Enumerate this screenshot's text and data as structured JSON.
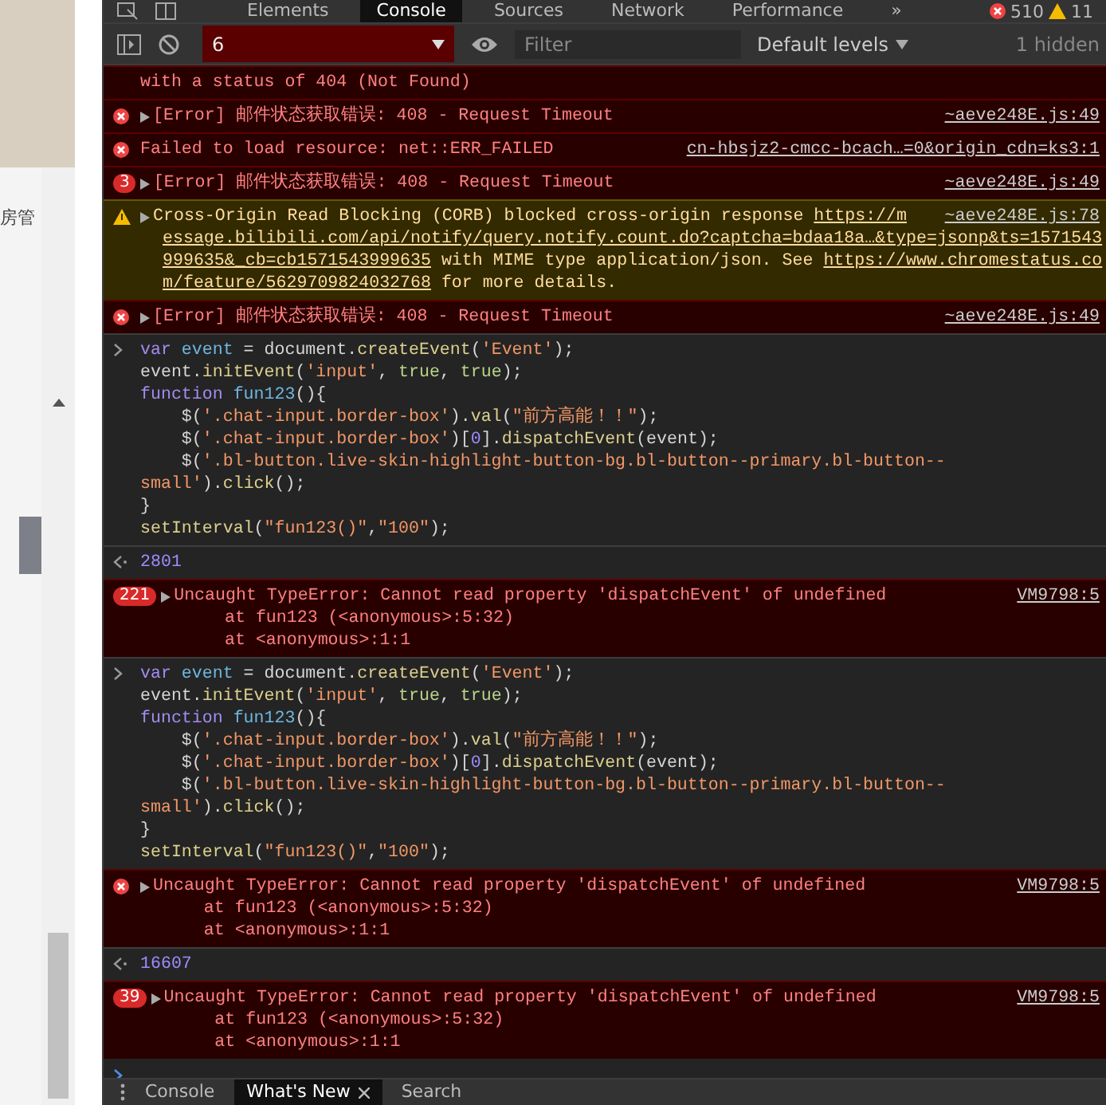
{
  "page": {
    "label": "房管"
  },
  "tabs": [
    {
      "label": "Elements",
      "selected": false
    },
    {
      "label": "Console",
      "selected": true
    },
    {
      "label": "Sources",
      "selected": false
    },
    {
      "label": "Network",
      "selected": false
    },
    {
      "label": "Performance",
      "selected": false
    }
  ],
  "more_tabs": "»",
  "error_count": "510",
  "warning_count": "11",
  "toolbar": {
    "context": "6",
    "filter_placeholder": "Filter",
    "levels": "Default levels",
    "hidden": "1 hidden"
  },
  "messages": [
    {
      "kind": "error",
      "icon": false,
      "expandable": false,
      "lines": [
        [
          {
            "text": "with a status of 404 (Not Found)",
            "kind": "plain"
          }
        ]
      ]
    },
    {
      "kind": "error",
      "icon": true,
      "expandable": true,
      "source": "~aeve248E.js:49",
      "lines": [
        [
          {
            "text": "[Error] 邮件状态获取错误: 408 - Request Timeout",
            "kind": "plain"
          }
        ]
      ]
    },
    {
      "kind": "error",
      "icon": true,
      "expandable": false,
      "source": "cn-hbsjz2-cmcc-bcach…=0&origin_cdn=ks3:1",
      "lines": [
        [
          {
            "text": "Failed to load resource: net::ERR_FAILED",
            "kind": "plain"
          }
        ]
      ]
    },
    {
      "kind": "error",
      "icon": false,
      "count": "3",
      "expandable": true,
      "source": "~aeve248E.js:49",
      "lines": [
        [
          {
            "text": "[Error] 邮件状态获取错误: 408 - Request Timeout",
            "kind": "plain"
          }
        ]
      ]
    },
    {
      "kind": "warning",
      "icon": true,
      "expandable": true,
      "source": "~aeve248E.js:78",
      "lines": [
        [
          {
            "text": "Cross-Origin Read Blocking (CORB) blocked cross-origin response ",
            "kind": "plain"
          },
          {
            "text": "https://m",
            "kind": "link"
          }
        ],
        [
          {
            "text": "essage.bilibili.com/api/notify/query.notify.count.do?captcha=bdaa18a…&type=jsonp&ts=1571543",
            "kind": "link"
          }
        ],
        [
          {
            "text": "999635&_cb=cb1571543999635",
            "kind": "link"
          },
          {
            "text": " with MIME type application/json. See ",
            "kind": "plain"
          },
          {
            "text": "https://www.chromestatus.co",
            "kind": "link"
          }
        ],
        [
          {
            "text": "m/feature/5629709824032768",
            "kind": "link"
          },
          {
            "text": " for more details.",
            "kind": "plain"
          }
        ]
      ]
    },
    {
      "kind": "error",
      "icon": true,
      "expandable": true,
      "source": "~aeve248E.js:49",
      "lines": [
        [
          {
            "text": "[Error] 邮件状态获取错误: 408 - Request Timeout",
            "kind": "plain"
          }
        ]
      ]
    },
    {
      "kind": "input",
      "lines": [
        [
          {
            "text": "var ",
            "kind": "keyword"
          },
          {
            "text": "event",
            "kind": "variable"
          },
          {
            "text": " = document.",
            "kind": "plain"
          },
          {
            "text": "createEvent",
            "kind": "property"
          },
          {
            "text": "(",
            "kind": "plain"
          },
          {
            "text": "'Event'",
            "kind": "string"
          },
          {
            "text": ");",
            "kind": "plain"
          }
        ],
        [
          {
            "text": "event.",
            "kind": "plain"
          },
          {
            "text": "initEvent",
            "kind": "property"
          },
          {
            "text": "(",
            "kind": "plain"
          },
          {
            "text": "'input'",
            "kind": "string"
          },
          {
            "text": ", ",
            "kind": "plain"
          },
          {
            "text": "true",
            "kind": "literal"
          },
          {
            "text": ", ",
            "kind": "plain"
          },
          {
            "text": "true",
            "kind": "literal"
          },
          {
            "text": ");",
            "kind": "plain"
          }
        ],
        [
          {
            "text": "function ",
            "kind": "keyword"
          },
          {
            "text": "fun123",
            "kind": "variable"
          },
          {
            "text": "(){",
            "kind": "plain"
          }
        ],
        [
          {
            "text": "    $(",
            "kind": "plain"
          },
          {
            "text": "'.chat-input.border-box'",
            "kind": "string"
          },
          {
            "text": ").",
            "kind": "plain"
          },
          {
            "text": "val",
            "kind": "property"
          },
          {
            "text": "(",
            "kind": "plain"
          },
          {
            "text": "\"前方高能！！\"",
            "kind": "string"
          },
          {
            "text": ");",
            "kind": "plain"
          }
        ],
        [
          {
            "text": "    $(",
            "kind": "plain"
          },
          {
            "text": "'.chat-input.border-box'",
            "kind": "string"
          },
          {
            "text": ")[",
            "kind": "plain"
          },
          {
            "text": "0",
            "kind": "number"
          },
          {
            "text": "].",
            "kind": "plain"
          },
          {
            "text": "dispatchEvent",
            "kind": "property"
          },
          {
            "text": "(event);",
            "kind": "plain"
          }
        ],
        [
          {
            "text": "    $(",
            "kind": "plain"
          },
          {
            "text": "'.bl-button.live-skin-highlight-button-bg.bl-button--primary.bl-button--",
            "kind": "string"
          }
        ],
        [
          {
            "text": "small'",
            "kind": "string"
          },
          {
            "text": ").",
            "kind": "plain"
          },
          {
            "text": "click",
            "kind": "property"
          },
          {
            "text": "();",
            "kind": "plain"
          }
        ],
        [
          {
            "text": "}",
            "kind": "plain"
          }
        ],
        [
          {
            "text": "setInterval",
            "kind": "property"
          },
          {
            "text": "(",
            "kind": "plain"
          },
          {
            "text": "\"fun123()\"",
            "kind": "string"
          },
          {
            "text": ",",
            "kind": "plain"
          },
          {
            "text": "\"100\"",
            "kind": "string"
          },
          {
            "text": ");",
            "kind": "plain"
          }
        ]
      ]
    },
    {
      "kind": "result",
      "lines": [
        [
          {
            "text": "2801",
            "kind": "number"
          }
        ]
      ]
    },
    {
      "kind": "error",
      "icon": false,
      "count": "221",
      "expandable": true,
      "source": "VM9798:5",
      "lines": [
        [
          {
            "text": "Uncaught TypeError: Cannot read property 'dispatchEvent' of undefined",
            "kind": "plain"
          }
        ],
        [
          {
            "text": "    at fun123 (<anonymous>:5:32)",
            "kind": "plain"
          }
        ],
        [
          {
            "text": "    at <anonymous>:1:1",
            "kind": "plain"
          }
        ]
      ]
    },
    {
      "kind": "input",
      "lines": [
        [
          {
            "text": "var ",
            "kind": "keyword"
          },
          {
            "text": "event",
            "kind": "variable"
          },
          {
            "text": " = document.",
            "kind": "plain"
          },
          {
            "text": "createEvent",
            "kind": "property"
          },
          {
            "text": "(",
            "kind": "plain"
          },
          {
            "text": "'Event'",
            "kind": "string"
          },
          {
            "text": ");",
            "kind": "plain"
          }
        ],
        [
          {
            "text": "event.",
            "kind": "plain"
          },
          {
            "text": "initEvent",
            "kind": "property"
          },
          {
            "text": "(",
            "kind": "plain"
          },
          {
            "text": "'input'",
            "kind": "string"
          },
          {
            "text": ", ",
            "kind": "plain"
          },
          {
            "text": "true",
            "kind": "literal"
          },
          {
            "text": ", ",
            "kind": "plain"
          },
          {
            "text": "true",
            "kind": "literal"
          },
          {
            "text": ");",
            "kind": "plain"
          }
        ],
        [
          {
            "text": "function ",
            "kind": "keyword"
          },
          {
            "text": "fun123",
            "kind": "variable"
          },
          {
            "text": "(){",
            "kind": "plain"
          }
        ],
        [
          {
            "text": "    $(",
            "kind": "plain"
          },
          {
            "text": "'.chat-input.border-box'",
            "kind": "string"
          },
          {
            "text": ").",
            "kind": "plain"
          },
          {
            "text": "val",
            "kind": "property"
          },
          {
            "text": "(",
            "kind": "plain"
          },
          {
            "text": "\"前方高能！！\"",
            "kind": "string"
          },
          {
            "text": ");",
            "kind": "plain"
          }
        ],
        [
          {
            "text": "    $(",
            "kind": "plain"
          },
          {
            "text": "'.chat-input.border-box'",
            "kind": "string"
          },
          {
            "text": ")[",
            "kind": "plain"
          },
          {
            "text": "0",
            "kind": "number"
          },
          {
            "text": "].",
            "kind": "plain"
          },
          {
            "text": "dispatchEvent",
            "kind": "property"
          },
          {
            "text": "(event);",
            "kind": "plain"
          }
        ],
        [
          {
            "text": "    $(",
            "kind": "plain"
          },
          {
            "text": "'.bl-button.live-skin-highlight-button-bg.bl-button--primary.bl-button--",
            "kind": "string"
          }
        ],
        [
          {
            "text": "small'",
            "kind": "string"
          },
          {
            "text": ").",
            "kind": "plain"
          },
          {
            "text": "click",
            "kind": "property"
          },
          {
            "text": "();",
            "kind": "plain"
          }
        ],
        [
          {
            "text": "}",
            "kind": "plain"
          }
        ],
        [
          {
            "text": "setInterval",
            "kind": "property"
          },
          {
            "text": "(",
            "kind": "plain"
          },
          {
            "text": "\"fun123()\"",
            "kind": "string"
          },
          {
            "text": ",",
            "kind": "plain"
          },
          {
            "text": "\"100\"",
            "kind": "string"
          },
          {
            "text": ");",
            "kind": "plain"
          }
        ]
      ]
    },
    {
      "kind": "error",
      "icon": true,
      "expandable": true,
      "source": "VM9798:5",
      "lines": [
        [
          {
            "text": "Uncaught TypeError: Cannot read property 'dispatchEvent' of undefined",
            "kind": "plain"
          }
        ],
        [
          {
            "text": "    at fun123 (<anonymous>:5:32)",
            "kind": "plain"
          }
        ],
        [
          {
            "text": "    at <anonymous>:1:1",
            "kind": "plain"
          }
        ]
      ]
    },
    {
      "kind": "result",
      "lines": [
        [
          {
            "text": "16607",
            "kind": "number"
          }
        ]
      ]
    },
    {
      "kind": "error",
      "icon": false,
      "count": "39",
      "expandable": true,
      "source": "VM9798:5",
      "lines": [
        [
          {
            "text": "Uncaught TypeError: Cannot read property 'dispatchEvent' of undefined",
            "kind": "plain"
          }
        ],
        [
          {
            "text": "    at fun123 (<anonymous>:5:32)",
            "kind": "plain"
          }
        ],
        [
          {
            "text": "    at <anonymous>:1:1",
            "kind": "plain"
          }
        ]
      ]
    },
    {
      "kind": "prompt"
    }
  ],
  "drawer_tabs": [
    {
      "label": "Console",
      "selected": false,
      "closable": false
    },
    {
      "label": "What's New",
      "selected": true,
      "closable": true
    },
    {
      "label": "Search",
      "selected": false,
      "closable": false
    }
  ]
}
